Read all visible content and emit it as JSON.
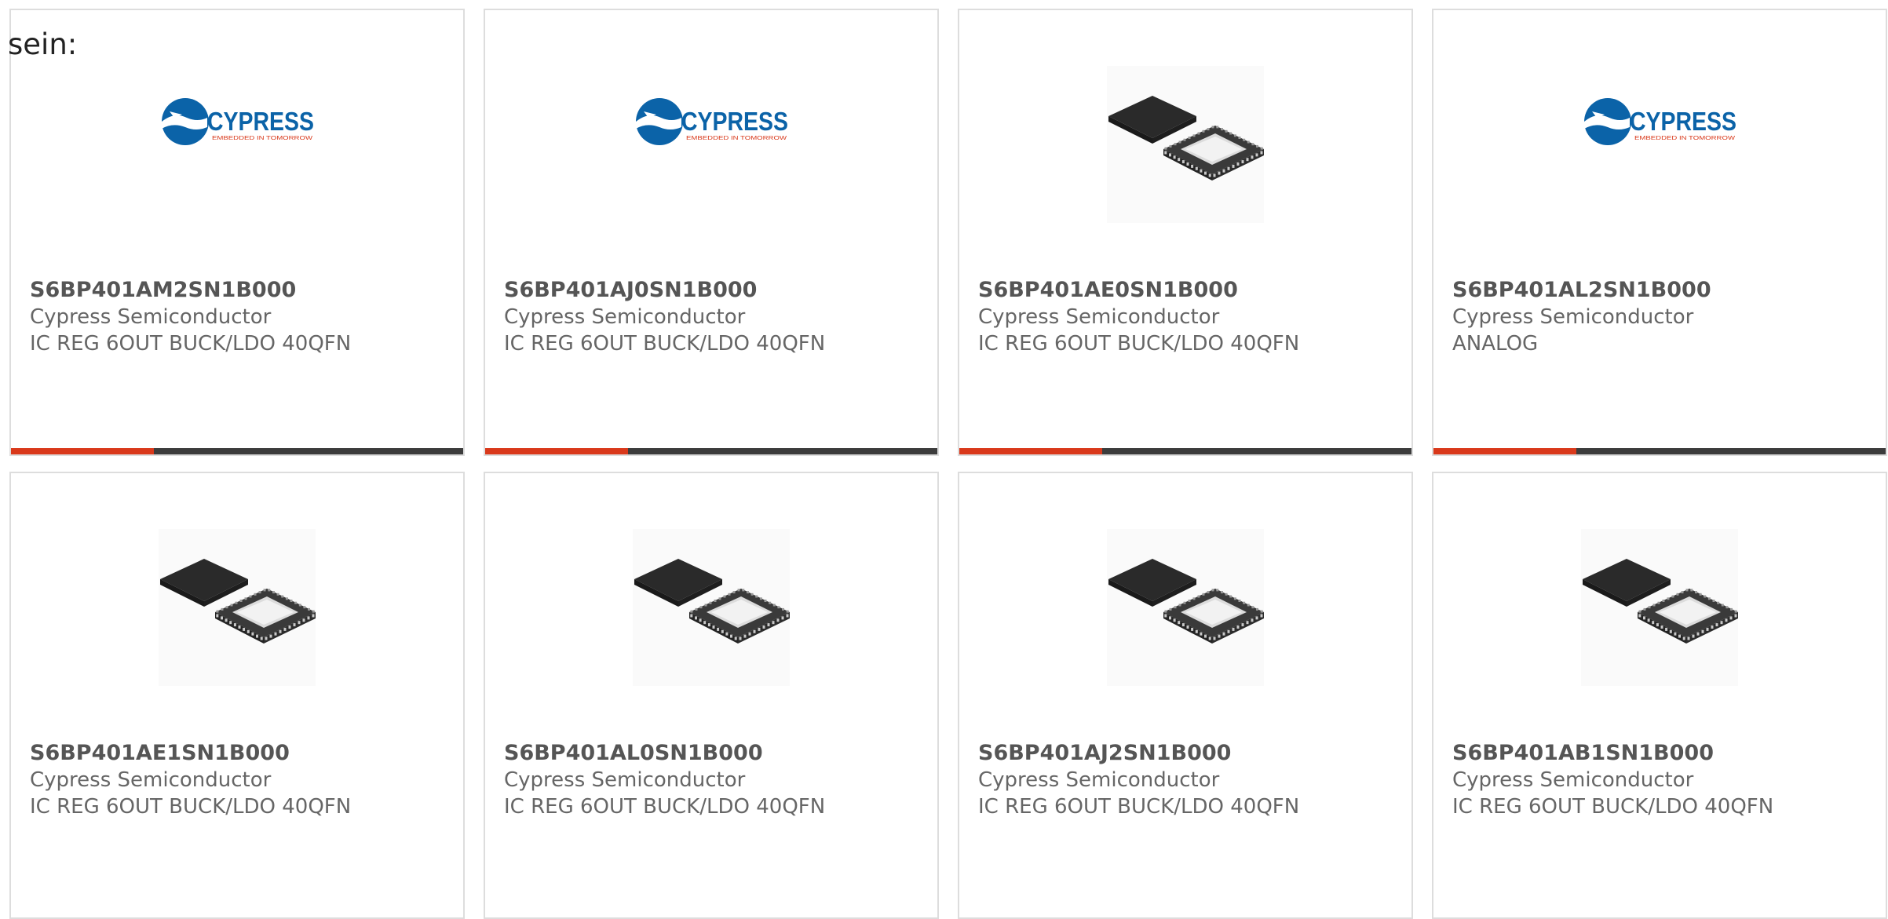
{
  "page": {
    "fragment_text": "sein:"
  },
  "colors": {
    "accent": "#d9391b",
    "bar_dark": "#3c3c3c",
    "brand_blue": "#0b63a8",
    "card_border": "#dddddd"
  },
  "logo": {
    "brand": "CYPRESS",
    "tagline": "EMBEDDED IN TOMORROW"
  },
  "products": [
    {
      "part_number": "S6BP401AM2SN1B000",
      "manufacturer": "Cypress Semiconductor",
      "description": "IC REG 6OUT BUCK/LDO 40QFN",
      "image": "cypress-logo-icon",
      "has_accent_bar": true
    },
    {
      "part_number": "S6BP401AJ0SN1B000",
      "manufacturer": "Cypress Semiconductor",
      "description": "IC REG 6OUT BUCK/LDO 40QFN",
      "image": "cypress-logo-icon",
      "has_accent_bar": true
    },
    {
      "part_number": "S6BP401AE0SN1B000",
      "manufacturer": "Cypress Semiconductor",
      "description": "IC REG 6OUT BUCK/LDO 40QFN",
      "image": "qfn-chip-icon",
      "has_accent_bar": true
    },
    {
      "part_number": "S6BP401AL2SN1B000",
      "manufacturer": "Cypress Semiconductor",
      "description": "ANALOG",
      "image": "cypress-logo-icon",
      "has_accent_bar": true
    },
    {
      "part_number": "S6BP401AE1SN1B000",
      "manufacturer": "Cypress Semiconductor",
      "description": "IC REG 6OUT BUCK/LDO 40QFN",
      "image": "qfn-chip-icon",
      "has_accent_bar": false
    },
    {
      "part_number": "S6BP401AL0SN1B000",
      "manufacturer": "Cypress Semiconductor",
      "description": "IC REG 6OUT BUCK/LDO 40QFN",
      "image": "qfn-chip-icon",
      "has_accent_bar": false
    },
    {
      "part_number": "S6BP401AJ2SN1B000",
      "manufacturer": "Cypress Semiconductor",
      "description": "IC REG 6OUT BUCK/LDO 40QFN",
      "image": "qfn-chip-icon",
      "has_accent_bar": false
    },
    {
      "part_number": "S6BP401AB1SN1B000",
      "manufacturer": "Cypress Semiconductor",
      "description": "IC REG 6OUT BUCK/LDO 40QFN",
      "image": "qfn-chip-icon",
      "has_accent_bar": false
    }
  ]
}
